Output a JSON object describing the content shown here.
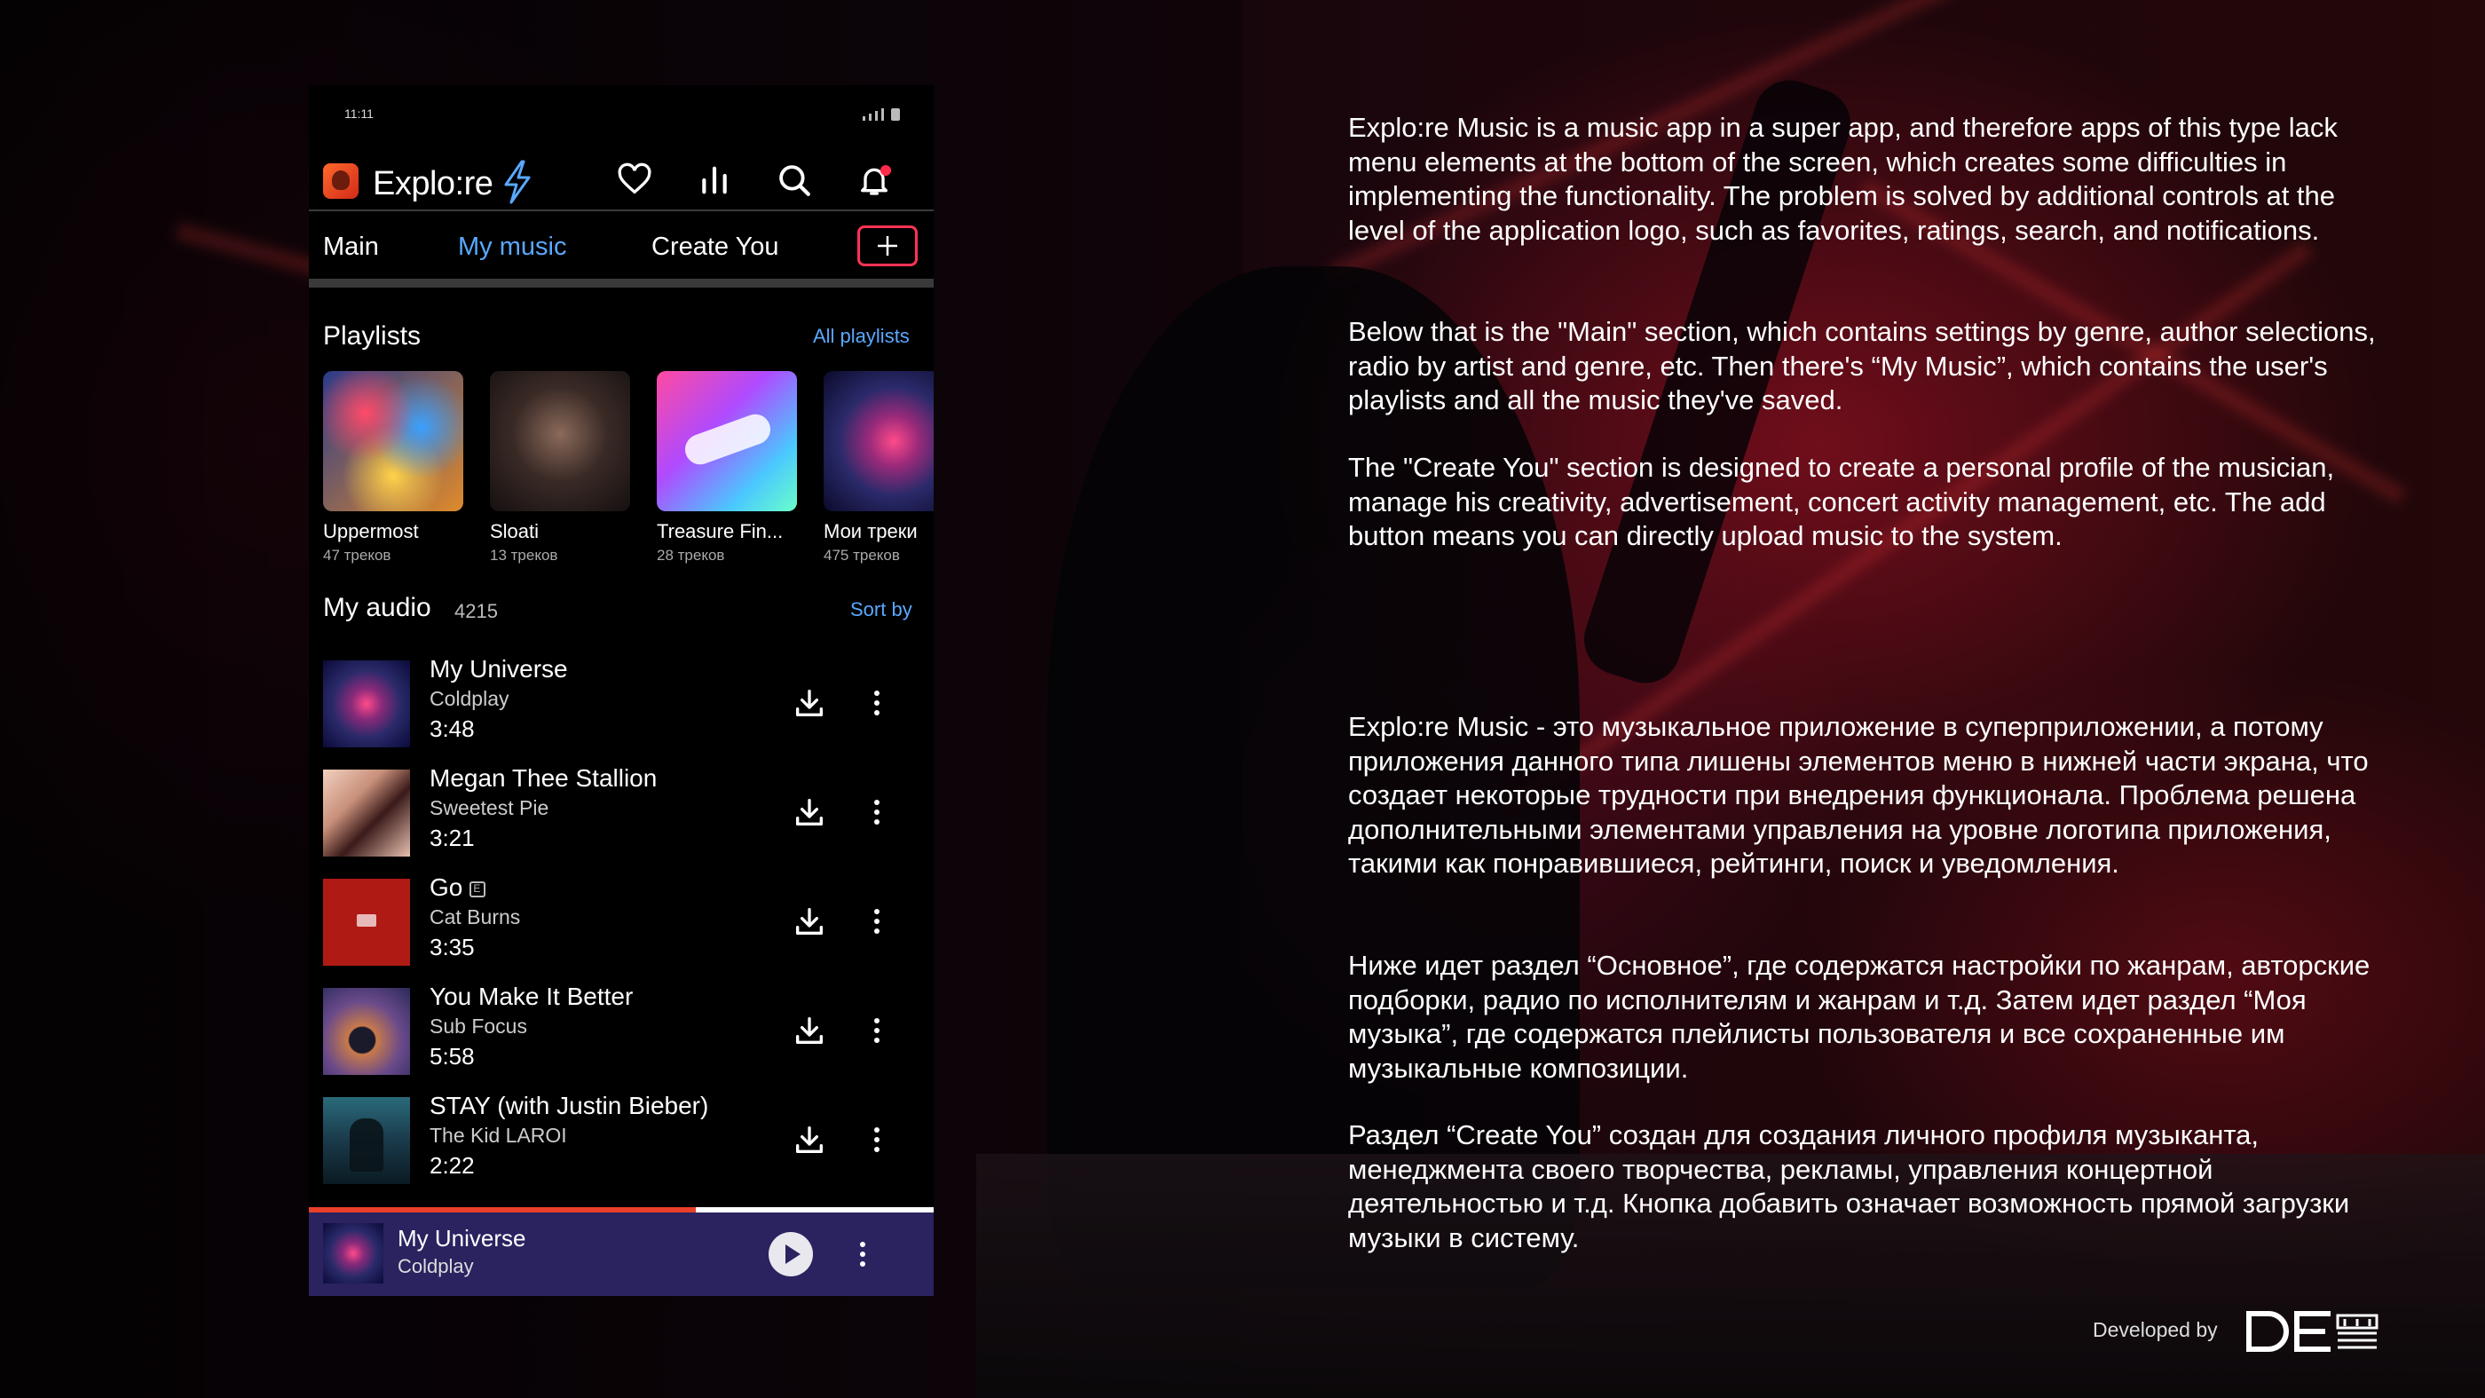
{
  "phone": {
    "status_time": "11:11",
    "brand": "Explo:re",
    "header_icons": [
      "heart-icon",
      "chart-bars-icon",
      "search-icon",
      "bell-icon"
    ],
    "tabs": [
      {
        "label": "Main",
        "active": false
      },
      {
        "label": "My music",
        "active": true
      },
      {
        "label": "Create You",
        "active": false
      }
    ],
    "playlists": {
      "title": "Playlists",
      "all_link": "All playlists",
      "items": [
        {
          "name": "Uppermost",
          "count": "47 треков"
        },
        {
          "name": "Sloati",
          "count": "13 треков"
        },
        {
          "name": "Treasure Fin...",
          "count": "28 треков"
        },
        {
          "name": "Мои треки",
          "count": "475 треков"
        }
      ]
    },
    "audio": {
      "title": "My audio",
      "count": "4215",
      "sort_label": "Sort by",
      "tracks": [
        {
          "title": "My Universe",
          "artist": "Coldplay",
          "duration": "3:48",
          "explicit": false
        },
        {
          "title": "Megan Thee Stallion",
          "artist": "Sweetest Pie",
          "duration": "3:21",
          "explicit": false
        },
        {
          "title": "Go",
          "artist": "Cat Burns",
          "duration": "3:35",
          "explicit": true
        },
        {
          "title": "You Make It Better",
          "artist": "Sub Focus",
          "duration": "5:58",
          "explicit": false
        },
        {
          "title": "STAY (with Justin Bieber)",
          "artist": "The Kid LAROI",
          "duration": "2:22",
          "explicit": false
        }
      ]
    },
    "player": {
      "title": "My Universe",
      "artist": "Coldplay",
      "progress": 0.62
    }
  },
  "colors": {
    "accent": "#5aa8ff",
    "add_button_border": "#ff3355",
    "player_bg": "#2a2360",
    "progress": "#e8402a"
  },
  "description": {
    "en": [
      "Explo:re Music is a music app in a super app, and therefore apps of this type lack menu elements at the bottom of the screen, which creates some difficulties in implementing the functionality. The problem is solved by additional controls at the level of the application logo, such as favorites, ratings, search, and notifications.",
      "Below that is the \"Main\" section, which contains settings by genre, author selections, radio by artist and genre, etc. Then there's “My Music”, which contains the user's playlists and all the music they've saved.",
      "The \"Create You\" section is designed to create a personal profile of the musician, manage his creativity, advertisement, concert activity management, etc. The add button means you can directly upload music to the system."
    ],
    "ru": [
      "Explo:re Music - это музыкальное приложение в суперприложении, а потому приложения данного типа лишены элементов меню в нижней части экрана, что создает некоторые трудности при внедрения функционала. Проблема решена дополнительными элементами управления на уровне логотипа приложения, такими как понравившиеся, рейтинги, поиск и уведомления.",
      "Ниже идет раздел “Основное”, где содержатся настройки по жанрам, авторские подборки, радио по исполнителям и жанрам и т.д. Затем идет раздел “Моя музыка”, где содержатся плейлисты пользователя и все сохраненные им музыкальные композиции.",
      "Раздел “Create You” создан для создания личного профиля музыканта, менеджмента своего творчества, рекламы, управления концертной деятельностью и т.д. Кнопка добавить означает возможность прямой загрузки музыки в систему."
    ]
  },
  "footer": {
    "developed_by": "Developed by",
    "logo_text": "DEM"
  }
}
